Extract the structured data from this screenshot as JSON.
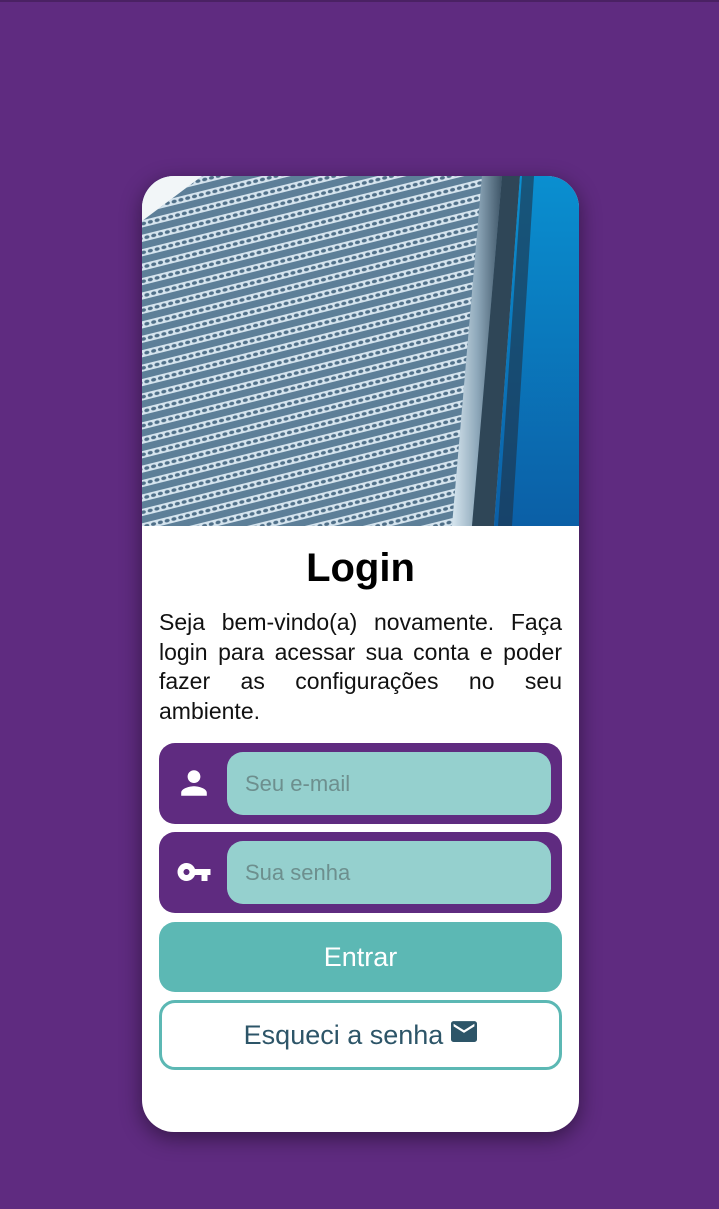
{
  "login": {
    "title": "Login",
    "description": "Seja bem-vindo(a) novamente. Faça login para acessar sua conta e poder fazer as configurações no seu ambiente.",
    "email": {
      "placeholder": "Seu e-mail",
      "value": "",
      "icon": "person-icon"
    },
    "password": {
      "placeholder": "Sua senha",
      "value": "",
      "icon": "key-icon"
    },
    "submit_label": "Entrar",
    "forgot_label": "Esqueci a senha",
    "forgot_icon": "mail-icon"
  },
  "colors": {
    "background": "#5f2b80",
    "field_bg": "#95d0ce",
    "primary_button": "#5cb8b4",
    "forgot_text": "#2d5568"
  }
}
